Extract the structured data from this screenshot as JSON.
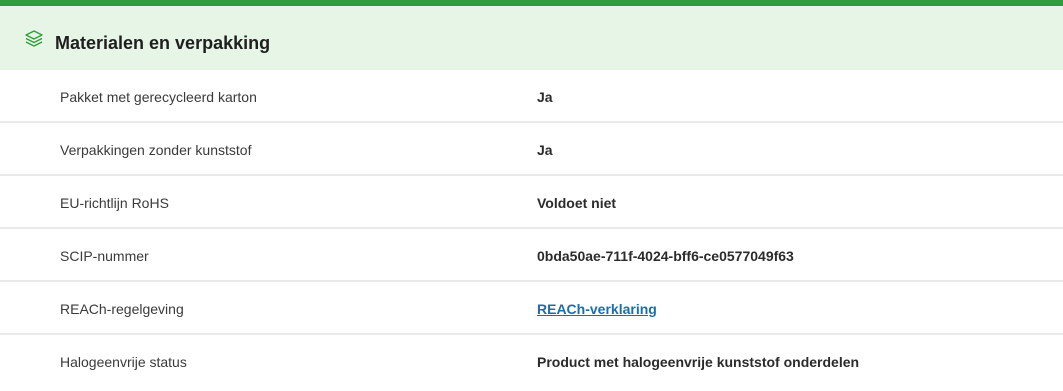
{
  "section": {
    "title": "Materialen en verpakking",
    "icon": "layers-icon",
    "accent_color": "#2e9e3a",
    "header_bg": "#e6f5e5"
  },
  "rows": [
    {
      "label": "Pakket met gerecycleerd karton",
      "value": "Ja"
    },
    {
      "label": "Verpakkingen zonder kunststof",
      "value": "Ja"
    },
    {
      "label": "EU-richtlijn RoHS",
      "value": "Voldoet niet"
    },
    {
      "label": "SCIP-nummer",
      "value": "0bda50ae-711f-4024-bff6-ce0577049f63"
    },
    {
      "label": "REACh-regelgeving",
      "link": "REACh-verklaring",
      "link_color": "#1b6fa6"
    },
    {
      "label": "Halogeenvrije status",
      "value": "Product met halogeenvrije kunststof onderdelen"
    }
  ]
}
